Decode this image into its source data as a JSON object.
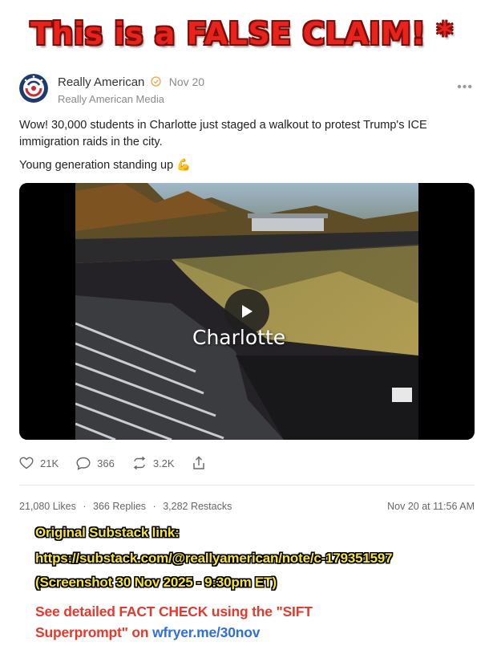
{
  "banner": {
    "text": "This is a FALSE CLAIM! *"
  },
  "post": {
    "author": "Really American",
    "date": "Nov 20",
    "publication": "Really American Media",
    "more_icon": "more-horizontal-icon",
    "paragraphs": [
      "Wow! 30,000 students in Charlotte just staged a walkout to protest Trump's ICE immigration raids in the city.",
      "Young generation standing up 💪"
    ],
    "video": {
      "overlay_label": "Charlotte",
      "play_icon": "play-icon"
    },
    "actions": {
      "likes": "21K",
      "comments": "366",
      "restacks": "3.2K"
    },
    "stats": {
      "likes": "21,080 Likes",
      "replies": "366 Replies",
      "restacks": "3,282 Restacks",
      "separator": "·"
    },
    "timestamp": "Nov 20 at 11:56 AM"
  },
  "annotation": {
    "line1": "Original Substack link:",
    "line2": "https://substack.com/@reallyamerican/note/c-179351597",
    "line3": "(Screenshot 30 Nov 2025 - 9:30pm ET)",
    "line4": "See detailed FACT CHECK using the \"SIFT",
    "line5_prefix": "Superprompt\" on",
    "line5_link": "wfryer.me/30nov"
  },
  "colors": {
    "banner_red": "#e8231c",
    "annotation_yellow": "#f7e53b",
    "annotation_red": "#e43a2d",
    "link_blue": "#2f6fd6",
    "verified_orange": "#f0a54a"
  }
}
